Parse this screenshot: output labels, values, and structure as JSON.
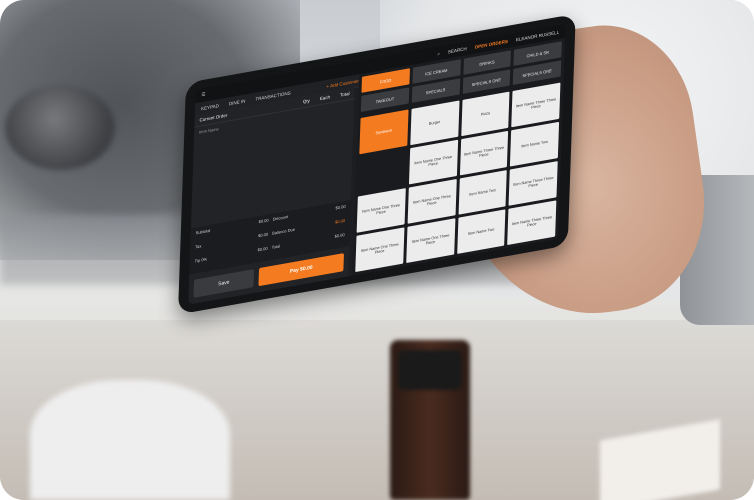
{
  "topbar": {
    "search": "SEARCH",
    "open_orders": "OPEN ORDERS",
    "user": "ELEANOR RUSSELL"
  },
  "nav": {
    "items": [
      "KEYPAD",
      "DINE IN",
      "TRANSACTIONS"
    ],
    "add_customer": "+ Add Customer"
  },
  "order": {
    "title": "Current Order",
    "columns": [
      "Qty",
      "Each",
      "Total"
    ],
    "item_header": "Item Name",
    "subtotal_label": "Subtotal",
    "subtotal_value": "$0.00",
    "discount_label": "Discount",
    "discount_value": "$0.00",
    "tax_label": "Tax",
    "tax_value": "$0.00",
    "balance_label": "Balance Due",
    "balance_value": "$0.00",
    "tip_label": "Tip 0%",
    "tip_value": "$0.00",
    "total_label": "Total",
    "total_value": "$0.00",
    "save_label": "Save",
    "pay_label": "Pay $0.00"
  },
  "categories": [
    "FOOD",
    "ICE CREAM",
    "DRINKS",
    "CHILD & SR",
    "TAKEOUT",
    "SPECIALS",
    "SPECIALS ONE",
    "SPECIALS ONE"
  ],
  "items": [
    "Sandwich",
    "Burger",
    "Pizza",
    "Item Name Three Three Piece",
    "",
    "Item Name One Three Piece",
    "Item Name Three Three Piece",
    "Item Name Two",
    "Item Name One Three Piece",
    "Item Name One Three Piece",
    "Item Name Two",
    "Item Name Three Three Piece",
    "Item Name One Three Piece",
    "Item Name One Three Piece",
    "Item Name Two",
    "Item Name Three Three Piece"
  ],
  "colors": {
    "accent": "#f47b20",
    "screen_bg": "#1d1e21",
    "item_bg": "#ececec"
  }
}
